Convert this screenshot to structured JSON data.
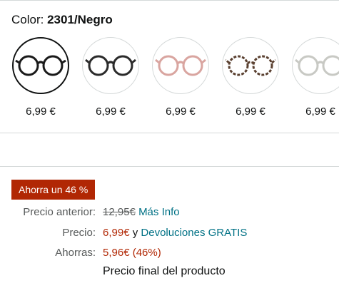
{
  "color_selector": {
    "label": "Color:",
    "selected": "2301/Negro",
    "swatches": [
      {
        "name": "negro-1",
        "price": "6,99 €",
        "frame_color": "#1a1a1a",
        "selected": true
      },
      {
        "name": "negro-2",
        "price": "6,99 €",
        "frame_color": "#2b2b2b",
        "selected": false
      },
      {
        "name": "rosa",
        "price": "6,99 €",
        "frame_color": "#d9a5a0",
        "selected": false
      },
      {
        "name": "carey",
        "price": "6,99 €",
        "frame_color": "#5a4030",
        "selected": false
      },
      {
        "name": "gris",
        "price": "6,99 €",
        "frame_color": "#c8c9c4",
        "selected": false
      }
    ]
  },
  "deal": {
    "badge": "Ahorra un 46 %",
    "previous_label": "Precio anterior:",
    "previous_value": "12,95€",
    "more_info": "Más Info",
    "price_label": "Precio:",
    "price_value": "6,99€",
    "price_connector": "y",
    "returns_link": "Devoluciones GRATIS",
    "savings_label": "Ahorras:",
    "savings_value": "5,96€ (46%)",
    "final_note": "Precio final del producto"
  }
}
